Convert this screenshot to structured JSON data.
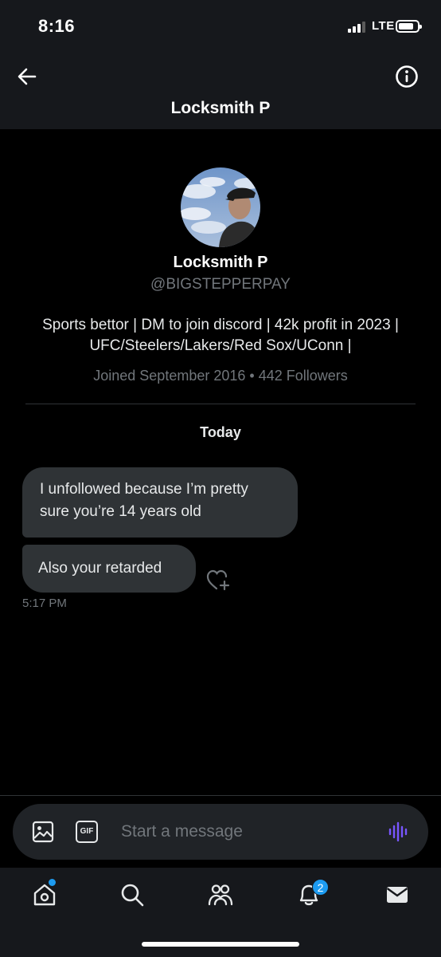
{
  "status_bar": {
    "time": "8:16",
    "network": "LTE",
    "signal_bars_active": 3,
    "signal_bars_total": 4,
    "battery_level": 0.7
  },
  "header": {
    "title": "Locksmith P",
    "back_icon": "arrow-left-icon",
    "info_icon": "info-circle-icon"
  },
  "profile": {
    "name": "Locksmith P",
    "handle": "@BIGSTEPPERPAY",
    "bio": "Sports bettor | DM to join discord | 42k profit in 2023 | UFC/Steelers/Lakers/Red Sox/UConn |",
    "meta": "Joined September 2016 • 442 Followers"
  },
  "conversation": {
    "date_separator": "Today",
    "messages": [
      {
        "text": "I unfollowed because I’m pretty sure you’re 14 years old"
      },
      {
        "text": "Also your retarded"
      }
    ],
    "last_timestamp": "5:17 PM"
  },
  "composer": {
    "placeholder": "Start a message",
    "gif_label": "GIF",
    "accent_color": "#7856ff"
  },
  "tab_bar": {
    "items": [
      {
        "name": "home",
        "icon": "home-icon",
        "has_dot": true
      },
      {
        "name": "search",
        "icon": "search-icon"
      },
      {
        "name": "communities",
        "icon": "people-icon"
      },
      {
        "name": "notifications",
        "icon": "bell-icon",
        "badge": "2"
      },
      {
        "name": "messages",
        "icon": "envelope-icon",
        "active": true
      }
    ]
  },
  "colors": {
    "background": "#000000",
    "bar": "#16181c",
    "bubble": "#2f3336",
    "secondary_text": "#71767b",
    "brand_blue": "#1d9bf0"
  }
}
